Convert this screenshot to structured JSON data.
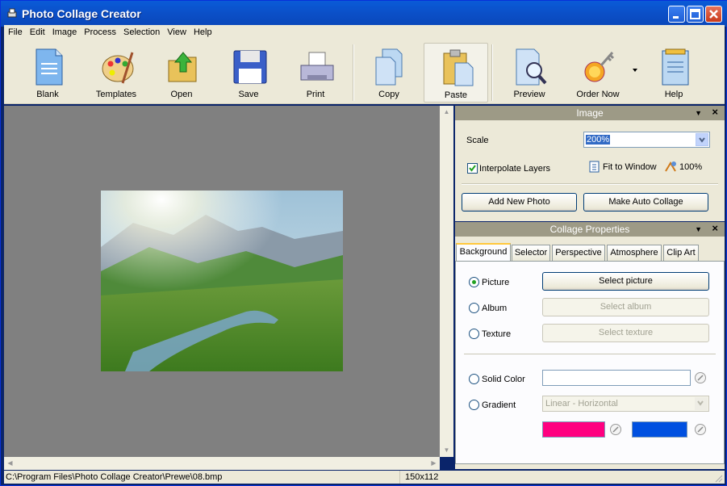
{
  "window": {
    "title": "Photo Collage Creator"
  },
  "menu": [
    "File",
    "Edit",
    "Image",
    "Process",
    "Selection",
    "View",
    "Help"
  ],
  "toolbar": {
    "blank": "Blank",
    "templates": "Templates",
    "open": "Open",
    "save": "Save",
    "print": "Print",
    "copy": "Copy",
    "paste": "Paste",
    "preview": "Preview",
    "order_now": "Order Now",
    "help": "Help"
  },
  "image_panel": {
    "title": "Image",
    "scale_label": "Scale",
    "scale_value": "200%",
    "interpolate_label": "Interpolate Layers",
    "interpolate_checked": true,
    "fit_to_window": "Fit to Window",
    "zoom_100": "100%",
    "add_new_photo": "Add New Photo",
    "make_auto_collage": "Make Auto Collage"
  },
  "collage_panel": {
    "title": "Collage Properties",
    "tabs": [
      "Background",
      "Selector",
      "Perspective",
      "Atmosphere",
      "Clip Art"
    ],
    "active_tab": "Background",
    "picture_label": "Picture",
    "select_picture": "Select picture",
    "album_label": "Album",
    "select_album": "Select album",
    "texture_label": "Texture",
    "select_texture": "Select texture",
    "solid_color_label": "Solid Color",
    "gradient_label": "Gradient",
    "gradient_value": "Linear - Horizontal",
    "gradient_color_1": "#ff0080",
    "gradient_color_2": "#0050e0"
  },
  "status": {
    "path": "C:\\Program Files\\Photo Collage Creator\\Prewe\\08.bmp",
    "dimensions": "150x112"
  }
}
